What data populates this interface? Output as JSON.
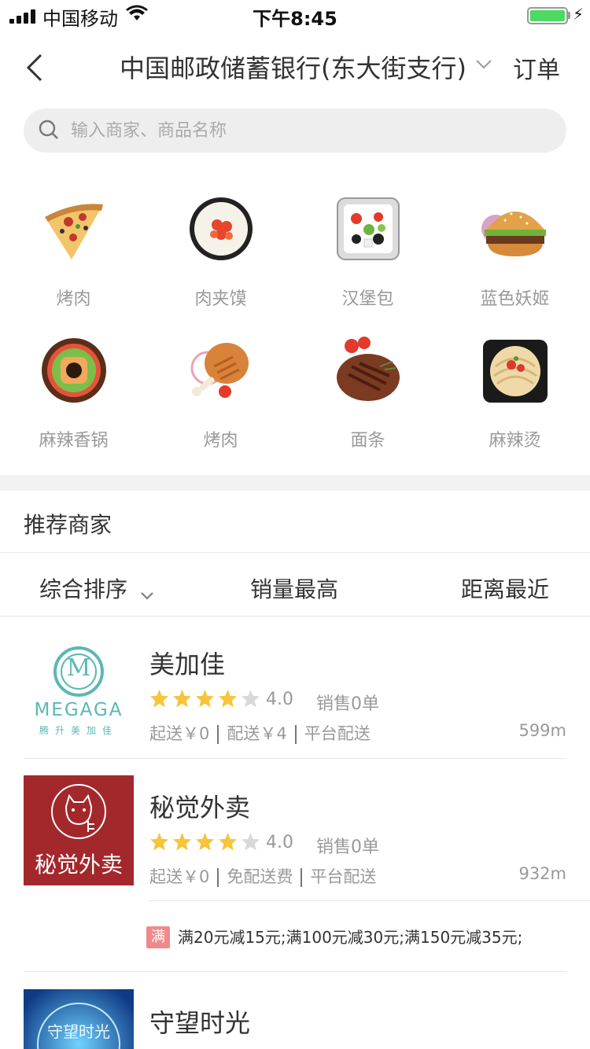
{
  "status_bar": {
    "carrier": "中国移动",
    "time": "下午8:45"
  },
  "nav": {
    "title": "中国邮政储蓄银行(东大街支行)",
    "order_label": "订单"
  },
  "search": {
    "placeholder": "输入商家、商品名称"
  },
  "categories": [
    {
      "label": "烤肉",
      "icon": "pizza-icon"
    },
    {
      "label": "肉夹馍",
      "icon": "sushi-roll-icon"
    },
    {
      "label": "汉堡包",
      "icon": "salad-icon"
    },
    {
      "label": "蓝色妖姬",
      "icon": "burger-icon"
    },
    {
      "label": "麻辣香锅",
      "icon": "bowl-icon"
    },
    {
      "label": "烤肉",
      "icon": "drumstick-icon"
    },
    {
      "label": "面条",
      "icon": "steak-icon"
    },
    {
      "label": "麻辣烫",
      "icon": "noodles-icon"
    }
  ],
  "recommended_title": "推荐商家",
  "sort_tabs": {
    "comprehensive": "综合排序",
    "sales": "销量最高",
    "distance": "距离最近"
  },
  "shops": [
    {
      "name": "美加佳",
      "rating": "4.0",
      "stars": 4,
      "sales": "销售0单",
      "min_order": "起送￥0",
      "delivery_fee": "配送￥4",
      "delivery_type": "平台配送",
      "distance": "599m",
      "logo": {
        "letter": "M",
        "brand": "MEGAGA",
        "tagline": "腾升美加佳"
      }
    },
    {
      "name": "秘觉外卖",
      "rating": "4.0",
      "stars": 4,
      "sales": "销售0单",
      "min_order": "起送￥0",
      "delivery_fee": "免配送费",
      "delivery_type": "平台配送",
      "distance": "932m",
      "logo": {
        "text": "秘觉外卖"
      },
      "promo": {
        "badge": "满",
        "text": "满20元减15元;满100元减30元;满150元减35元;"
      }
    },
    {
      "name": "守望时光",
      "logo": {
        "text": "守望时光"
      }
    }
  ],
  "colors": {
    "star": "#f7c43a",
    "star_empty": "#d9d9d9",
    "promo_badge": "#f08a8a",
    "battery": "#4cd964"
  }
}
